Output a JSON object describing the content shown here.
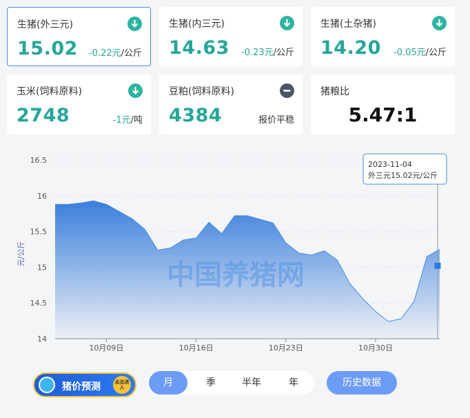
{
  "cards": [
    {
      "name": "生猪(外三元)",
      "price": "15.02",
      "delta": "-0.22元",
      "unit": "/公斤",
      "icon": "arrow-down-icon"
    },
    {
      "name": "生猪(内三元)",
      "price": "14.63",
      "delta": "-0.23元",
      "unit": "/公斤",
      "icon": "arrow-down-icon"
    },
    {
      "name": "生猪(土杂猪)",
      "price": "14.20",
      "delta": "-0.05元",
      "unit": "/公斤",
      "icon": "arrow-down-icon"
    },
    {
      "name": "玉米(饲料原料)",
      "price": "2748",
      "delta": "-1元",
      "unit": "/吨",
      "icon": "arrow-down-icon"
    },
    {
      "name": "豆粕(饲料原料)",
      "price": "4384",
      "status": "报价平稳",
      "icon": "minus-icon"
    },
    {
      "name": "猪粮比",
      "ratio": "5.47:1"
    }
  ],
  "colors": {
    "accent": "#26a69a",
    "line": "#4a8fe0",
    "button": "#6c9cf7"
  },
  "chart_data": {
    "type": "area",
    "ylabel": "元/公斤",
    "ylim": [
      14,
      16.5
    ],
    "yticks": [
      "14",
      "14.5",
      "15",
      "15.5",
      "16",
      "16.5"
    ],
    "xticks": [
      {
        "label": "10月09日",
        "date": "2023-10-09"
      },
      {
        "label": "10月16日",
        "date": "2023-10-16"
      },
      {
        "label": "10月23日",
        "date": "2023-10-23"
      },
      {
        "label": "10月30日",
        "date": "2023-10-30"
      }
    ],
    "x": [
      "2023-10-05",
      "2023-10-06",
      "2023-10-07",
      "2023-10-08",
      "2023-10-09",
      "2023-10-10",
      "2023-10-11",
      "2023-10-12",
      "2023-10-13",
      "2023-10-14",
      "2023-10-15",
      "2023-10-16",
      "2023-10-17",
      "2023-10-18",
      "2023-10-19",
      "2023-10-20",
      "2023-10-21",
      "2023-10-22",
      "2023-10-23",
      "2023-10-24",
      "2023-10-25",
      "2023-10-26",
      "2023-10-27",
      "2023-10-28",
      "2023-10-29",
      "2023-10-30",
      "2023-10-31",
      "2023-11-01",
      "2023-11-02",
      "2023-11-03",
      "2023-11-04"
    ],
    "series": [
      {
        "values": [
          15.88,
          15.88,
          15.9,
          15.93,
          15.88,
          15.78,
          15.68,
          15.53,
          15.24,
          15.27,
          15.38,
          15.41,
          15.63,
          15.47,
          15.72,
          15.72,
          15.67,
          15.62,
          15.34,
          15.2,
          15.17,
          15.23,
          15.1,
          14.77,
          14.56,
          14.38,
          14.24,
          14.28,
          14.52,
          15.15,
          15.25
        ]
      }
    ],
    "tooltip": {
      "date": "2023-11-04",
      "text": "外三元15.02元/公斤"
    },
    "watermark": "中国养猪网",
    "grid": true
  },
  "footer": {
    "predict_label": "猪价预测",
    "predict_badge": "点击进入",
    "periods": [
      "月",
      "季",
      "半年",
      "年"
    ],
    "active_period": "月",
    "history_label": "历史数据"
  }
}
